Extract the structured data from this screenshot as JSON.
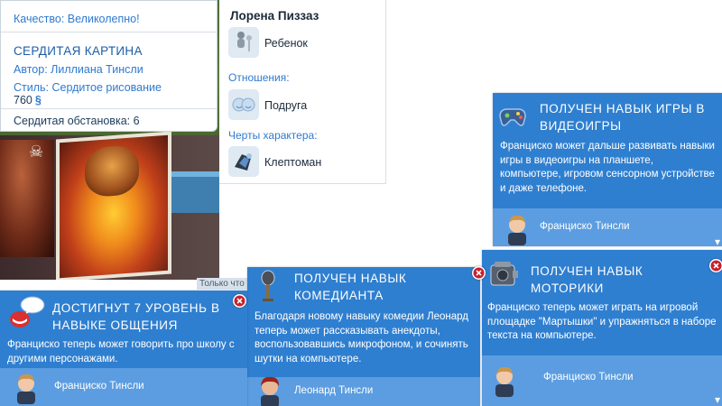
{
  "tooltip": {
    "quality": "Качество: Великолепно!",
    "title": "Сердитая картина",
    "author": "Автор: Лиллиана Тинсли",
    "style": "Стиль: Сердитое рисование",
    "price": "760",
    "currency_icon": "simoleon-icon",
    "ambience": "Сердитая обстановка: 6"
  },
  "sim_panel": {
    "name": "Лорена Пиззаз",
    "age": "Ребенок",
    "relationship_label": "Отношения:",
    "relationship_value": "Подруга",
    "traits_label": "Черты характера:",
    "trait_value": "Клептоман"
  },
  "clipped_text": "Только что",
  "notifications": {
    "video_games": {
      "title": "Получен навык игры в видеоигры",
      "text": "Франциско может дальше развивать навыки игры в видеоигры на планшете, компьютере, игровом сенсорном устройстве и даже телефоне.",
      "who": "Франциско Тинсли",
      "icon": "gamepad-icon"
    },
    "social": {
      "title": "Достигнут 7 уровень в навыке общения",
      "text": "Франциско теперь может говорить про школу с другими персонажами.",
      "who": "Франциско Тинсли",
      "icon": "speech-bubble-icon"
    },
    "comedy": {
      "title": "Получен навык комедианта",
      "text": "Благодаря новому навыку комедии Леонард теперь может рассказывать анекдоты, воспользовавшись микрофоном, и сочинять шутки на компьютере.",
      "who": "Леонард Тинсли",
      "icon": "microphone-icon"
    },
    "motor": {
      "title": "Получен навык моторики",
      "text": "Франциско теперь может играть на игровой площадке \"Мартышки\" и упражняться в наборе текста на компьютере.",
      "who": "Франциско Тинсли",
      "icon": "engine-icon"
    }
  },
  "colors": {
    "notification_blue": "#2f7fd0",
    "footer_blue": "#5b9de0",
    "link_blue": "#2e7ad0",
    "close_red": "#c8212b"
  }
}
